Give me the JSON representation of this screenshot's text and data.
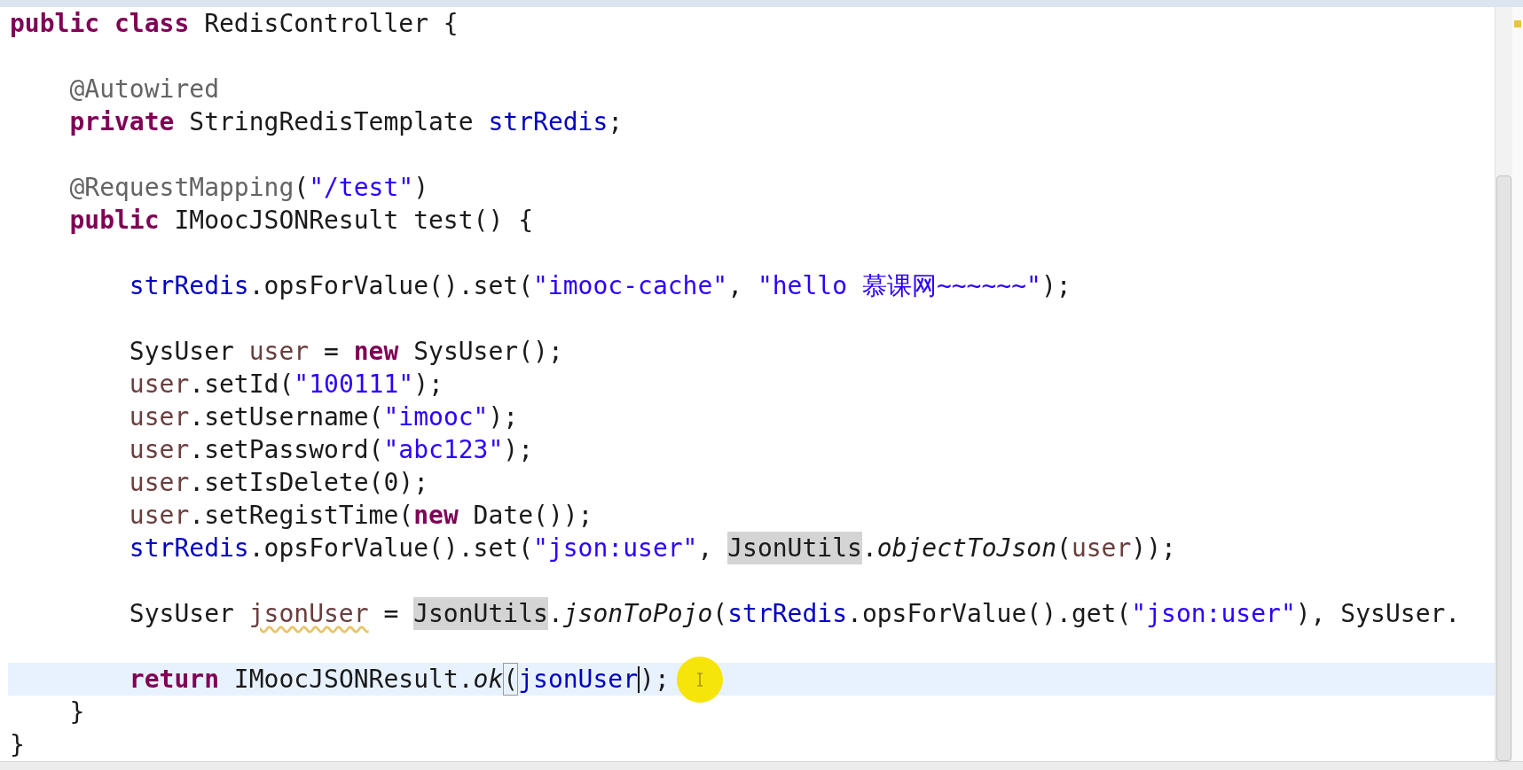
{
  "code": [
    {
      "kind": "code",
      "current": false,
      "tokens": [
        {
          "kind": "kw",
          "text": "public class"
        },
        {
          "kind": "plain",
          "text": " RedisController {"
        }
      ],
      "children": [
        {
          "kind": "blank"
        },
        {
          "kind": "code",
          "current": false,
          "tokens": [
            {
              "kind": "ann",
              "text": "@Autowired"
            }
          ]
        },
        {
          "kind": "code",
          "current": false,
          "tokens": [
            {
              "kind": "kw",
              "text": "private"
            },
            {
              "kind": "plain",
              "text": " StringRedisTemplate "
            },
            {
              "kind": "field",
              "text": "strRedis"
            },
            {
              "kind": "plain",
              "text": ";"
            }
          ]
        },
        {
          "kind": "blank"
        },
        {
          "kind": "code",
          "current": false,
          "tokens": [
            {
              "kind": "ann",
              "text": "@RequestMapping"
            },
            {
              "kind": "plain",
              "text": "("
            },
            {
              "kind": "str",
              "text": "\"/test\""
            },
            {
              "kind": "plain",
              "text": ")"
            }
          ]
        },
        {
          "kind": "code",
          "current": false,
          "tokens": [
            {
              "kind": "kw",
              "text": "public"
            },
            {
              "kind": "plain",
              "text": " IMoocJSONResult test() {"
            }
          ],
          "children": [
            {
              "kind": "blank"
            },
            {
              "kind": "code",
              "current": false,
              "tokens": [
                {
                  "kind": "field",
                  "text": "strRedis"
                },
                {
                  "kind": "plain",
                  "text": ".opsForValue().set("
                },
                {
                  "kind": "str",
                  "text": "\"imooc-cache\""
                },
                {
                  "kind": "plain",
                  "text": ", "
                },
                {
                  "kind": "str",
                  "text": "\"hello 慕课网~~~~~~\""
                },
                {
                  "kind": "plain",
                  "text": ");"
                }
              ]
            },
            {
              "kind": "blank"
            },
            {
              "kind": "code",
              "current": false,
              "tokens": [
                {
                  "kind": "plain",
                  "text": "SysUser "
                },
                {
                  "kind": "local",
                  "text": "user"
                },
                {
                  "kind": "plain",
                  "text": " = "
                },
                {
                  "kind": "kw",
                  "text": "new"
                },
                {
                  "kind": "plain",
                  "text": " SysUser();"
                }
              ]
            },
            {
              "kind": "code",
              "current": false,
              "tokens": [
                {
                  "kind": "local",
                  "text": "user"
                },
                {
                  "kind": "plain",
                  "text": ".setId("
                },
                {
                  "kind": "str",
                  "text": "\"100111\""
                },
                {
                  "kind": "plain",
                  "text": ");"
                }
              ]
            },
            {
              "kind": "code",
              "current": false,
              "tokens": [
                {
                  "kind": "local",
                  "text": "user"
                },
                {
                  "kind": "plain",
                  "text": ".setUsername("
                },
                {
                  "kind": "str",
                  "text": "\"imooc\""
                },
                {
                  "kind": "plain",
                  "text": ");"
                }
              ]
            },
            {
              "kind": "code",
              "current": false,
              "tokens": [
                {
                  "kind": "local",
                  "text": "user"
                },
                {
                  "kind": "plain",
                  "text": ".setPassword("
                },
                {
                  "kind": "str",
                  "text": "\"abc123\""
                },
                {
                  "kind": "plain",
                  "text": ");"
                }
              ]
            },
            {
              "kind": "code",
              "current": false,
              "tokens": [
                {
                  "kind": "local",
                  "text": "user"
                },
                {
                  "kind": "plain",
                  "text": ".setIsDelete(0);"
                }
              ]
            },
            {
              "kind": "code",
              "current": false,
              "tokens": [
                {
                  "kind": "local",
                  "text": "user"
                },
                {
                  "kind": "plain",
                  "text": ".setRegistTime("
                },
                {
                  "kind": "kw",
                  "text": "new"
                },
                {
                  "kind": "plain",
                  "text": " Date());"
                }
              ]
            },
            {
              "kind": "code",
              "current": false,
              "tokens": [
                {
                  "kind": "field",
                  "text": "strRedis"
                },
                {
                  "kind": "plain",
                  "text": ".opsForValue().set("
                },
                {
                  "kind": "str",
                  "text": "\"json:user\""
                },
                {
                  "kind": "plain",
                  "text": ", "
                },
                {
                  "kind": "occ",
                  "text": "JsonUtils"
                },
                {
                  "kind": "plain",
                  "text": "."
                },
                {
                  "kind": "static",
                  "text": "objectToJson"
                },
                {
                  "kind": "plain",
                  "text": "("
                },
                {
                  "kind": "local",
                  "text": "user"
                },
                {
                  "kind": "plain",
                  "text": "));"
                }
              ]
            },
            {
              "kind": "blank"
            },
            {
              "kind": "code",
              "current": false,
              "tokens": [
                {
                  "kind": "plain",
                  "text": "SysUser "
                },
                {
                  "kind": "warn",
                  "text": "jsonUser"
                },
                {
                  "kind": "plain",
                  "text": " = "
                },
                {
                  "kind": "occ",
                  "text": "JsonUtils"
                },
                {
                  "kind": "plain",
                  "text": "."
                },
                {
                  "kind": "static",
                  "text": "jsonToPojo"
                },
                {
                  "kind": "plain",
                  "text": "("
                },
                {
                  "kind": "field",
                  "text": "strRedis"
                },
                {
                  "kind": "plain",
                  "text": ".opsForValue().get("
                },
                {
                  "kind": "str",
                  "text": "\"json:user\""
                },
                {
                  "kind": "plain",
                  "text": "), SysUser."
                }
              ]
            },
            {
              "kind": "blank"
            },
            {
              "kind": "code",
              "current": true,
              "tokens": [
                {
                  "kind": "kw",
                  "text": "return"
                },
                {
                  "kind": "plain",
                  "text": " IMoocJSONResult."
                },
                {
                  "kind": "static",
                  "text": "ok"
                },
                {
                  "kind": "bracket",
                  "text": "("
                },
                {
                  "kind": "var",
                  "text": "jsonUser",
                  "caret": true
                },
                {
                  "kind": "plain",
                  "text": ");"
                }
              ]
            }
          ]
        },
        {
          "kind": "code",
          "current": false,
          "tokens": [
            {
              "kind": "plain",
              "text": "}"
            }
          ]
        }
      ]
    },
    {
      "kind": "code",
      "current": false,
      "tokens": [
        {
          "kind": "plain",
          "text": "}"
        }
      ]
    }
  ]
}
